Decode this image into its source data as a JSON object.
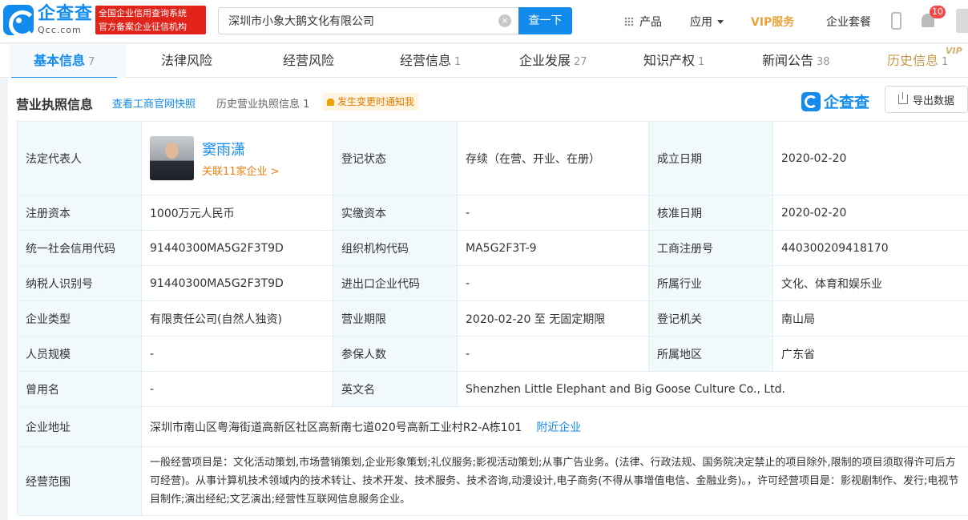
{
  "header": {
    "logo_cn": "企查查",
    "logo_en": "Qcc.com",
    "slogan_line1": "全国企业信用查询系统",
    "slogan_line2": "官方备案企业征信机构",
    "search_value": "深圳市小象大鹅文化有限公司",
    "search_button": "查一下",
    "nav_products": "产品",
    "nav_apps": "应用",
    "nav_vip": "VIP服务",
    "nav_package": "企业套餐",
    "notify_count": "10"
  },
  "tabs": [
    {
      "label": "基本信息",
      "count": "7"
    },
    {
      "label": "法律风险",
      "count": ""
    },
    {
      "label": "经营风险",
      "count": ""
    },
    {
      "label": "经营信息",
      "count": "1"
    },
    {
      "label": "企业发展",
      "count": "27"
    },
    {
      "label": "知识产权",
      "count": "1"
    },
    {
      "label": "新闻公告",
      "count": "38"
    },
    {
      "label": "历史信息",
      "count": "1"
    }
  ],
  "vip_tag": "VIP",
  "section": {
    "title": "营业执照信息",
    "snapshot_link": "查看工商官网快照",
    "history_link": "历史营业执照信息 1",
    "notify": "发生变更时通知我",
    "brand": "企查查",
    "export": "导出数据"
  },
  "rows": {
    "legal_rep_label": "法定代表人",
    "legal_rep_name": "窦雨潇",
    "legal_rep_link": "关联11家企业 >",
    "reg_status_label": "登记状态",
    "reg_status": "存续（在营、开业、在册）",
    "found_date_label": "成立日期",
    "found_date": "2020-02-20",
    "reg_capital_label": "注册资本",
    "reg_capital": "1000万元人民币",
    "paid_capital_label": "实缴资本",
    "paid_capital": "-",
    "approve_date_label": "核准日期",
    "approve_date": "2020-02-20",
    "credit_code_label": "统一社会信用代码",
    "credit_code": "91440300MA5G2F3T9D",
    "org_code_label": "组织机构代码",
    "org_code": "MA5G2F3T-9",
    "biz_reg_no_label": "工商注册号",
    "biz_reg_no": "440300209418170",
    "taxpayer_label": "纳税人识别号",
    "taxpayer": "91440300MA5G2F3T9D",
    "import_code_label": "进出口企业代码",
    "import_code": "-",
    "industry_label": "所属行业",
    "industry": "文化、体育和娱乐业",
    "type_label": "企业类型",
    "type": "有限责任公司(自然人独资)",
    "term_label": "营业期限",
    "term": "2020-02-20 至 无固定期限",
    "authority_label": "登记机关",
    "authority": "南山局",
    "staff_label": "人员规模",
    "staff": "-",
    "insured_label": "参保人数",
    "insured": "-",
    "region_label": "所属地区",
    "region": "广东省",
    "former_name_label": "曾用名",
    "former_name": "-",
    "en_name_label": "英文名",
    "en_name": "Shenzhen Little Elephant and Big Goose Culture Co., Ltd.",
    "address_label": "企业地址",
    "address": "深圳市南山区粤海街道高新区社区高新南七道020号高新工业村R2-A栋101",
    "nearby_link": "附近企业",
    "scope_label": "经营范围",
    "scope": "一般经营项目是：文化活动策划,市场营销策划,企业形象策划;礼仪服务;影视活动策划;从事广告业务。(法律、行政法规、国务院决定禁止的项目除外,限制的项目须取得许可后方可经营)。从事计算机技术领域内的技术转让、技术开发、技术服务、技术咨询,动漫设计,电子商务(不得从事增值电信、金融业务)。，许可经营项目是：影视剧制作、发行;电视节目制作;演出经纪;文艺演出;经营性互联网信息服务企业。"
  }
}
